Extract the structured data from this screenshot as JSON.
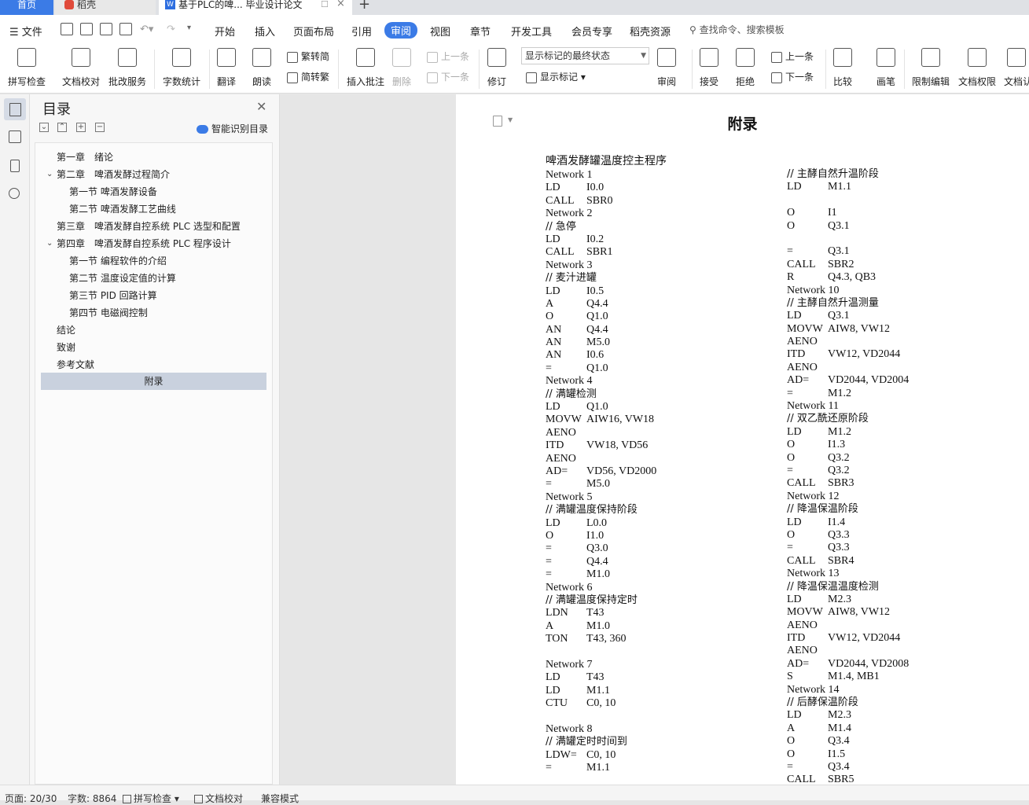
{
  "tabs": {
    "home": "首页",
    "daoke": "稻壳",
    "doc": "基于PLC的啤... 毕业设计论文",
    "new_tab": "+"
  },
  "menu": {
    "file": "文件",
    "items": [
      "开始",
      "插入",
      "页面布局",
      "引用",
      "审阅",
      "视图",
      "章节",
      "开发工具",
      "会员专享",
      "稻壳资源"
    ],
    "active": "审阅",
    "search": "查找命令、搜索模板"
  },
  "ribbon": {
    "spell": "拼写检查",
    "doccheck": "文档校对",
    "review_service": "批改服务",
    "wordcount": "字数统计",
    "translate": "翻译",
    "read": "朗读",
    "trad": "繁转简",
    "simp": "简转繁",
    "insert_comment": "插入批注",
    "delete": "删除",
    "prev": "上一条",
    "next": "下一条",
    "track": "修订",
    "markup_select": "显示标记的最终状态",
    "show_markup": "显示标记",
    "review": "审阅",
    "accept": "接受",
    "reject": "拒绝",
    "prev2": "上一条",
    "next2": "下一条",
    "compare": "比较",
    "pen": "画笔",
    "restrict": "限制编辑",
    "perm": "文档权限",
    "cert": "文档认"
  },
  "nav": {
    "title": "目录",
    "smart": "智能识别目录",
    "items": [
      "第一章　绪论",
      "第二章　啤酒发酵过程简介",
      "第一节  啤酒发酵设备",
      "第二节  啤酒发酵工艺曲线",
      "第三章　啤酒发酵自控系统 PLC 选型和配置",
      "第四章　啤酒发酵自控系统 PLC 程序设计",
      "第一节  编程软件的介绍",
      "第二节  温度设定值的计算",
      "第三节  PID 回路计算",
      "第四节  电磁阀控制",
      "结论",
      "致谢",
      "参考文献",
      "附录"
    ]
  },
  "document": {
    "title": "附录",
    "heading": "啤酒发酵罐温度控主程序",
    "col1": [
      [
        "Network 1",
        ""
      ],
      [
        "LD",
        "I0.0"
      ],
      [
        "CALL",
        "SBR0"
      ],
      [
        "Network 2",
        ""
      ],
      [
        "// 急停",
        ""
      ],
      [
        "LD",
        "I0.2"
      ],
      [
        "CALL",
        "SBR1"
      ],
      [
        "Network 3",
        ""
      ],
      [
        "// 麦汁进罐",
        ""
      ],
      [
        "LD",
        "I0.5"
      ],
      [
        "A",
        "Q4.4"
      ],
      [
        "O",
        "Q1.0"
      ],
      [
        "AN",
        "Q4.4"
      ],
      [
        "AN",
        "M5.0"
      ],
      [
        "AN",
        "I0.6"
      ],
      [
        "=",
        "Q1.0"
      ],
      [
        "Network 4",
        ""
      ],
      [
        "// 满罐检测",
        ""
      ],
      [
        "LD",
        "Q1.0"
      ],
      [
        "MOVW",
        "AIW16, VW18"
      ],
      [
        "AENO",
        ""
      ],
      [
        "ITD",
        "VW18, VD56"
      ],
      [
        "AENO",
        ""
      ],
      [
        "AD=",
        "VD56, VD2000"
      ],
      [
        "=",
        "M5.0"
      ],
      [
        "Network 5",
        ""
      ],
      [
        "// 满罐温度保持阶段",
        ""
      ],
      [
        "LD",
        "L0.0"
      ],
      [
        "O",
        "I1.0"
      ],
      [
        "=",
        "Q3.0"
      ],
      [
        "=",
        "Q4.4"
      ],
      [
        "=",
        "M1.0"
      ],
      [
        "Network 6",
        ""
      ],
      [
        "// 满罐温度保持定时",
        ""
      ],
      [
        "LDN",
        "T43"
      ],
      [
        "A",
        "M1.0"
      ],
      [
        "TON",
        "T43, 360"
      ],
      [
        "",
        ""
      ],
      [
        "Network 7",
        ""
      ],
      [
        "LD",
        "T43"
      ],
      [
        "LD",
        "M1.1"
      ],
      [
        "CTU",
        "C0, 10"
      ],
      [
        "",
        ""
      ],
      [
        "Network 8",
        ""
      ],
      [
        "// 满罐定时时间到",
        ""
      ],
      [
        "LDW=",
        "C0, 10"
      ],
      [
        "=",
        "M1.1"
      ]
    ],
    "col2": [
      [
        "// 主酵自然升温阶段",
        ""
      ],
      [
        "LD",
        "M1.1"
      ],
      [
        "",
        ""
      ],
      [
        "O",
        "I1"
      ],
      [
        "O",
        "Q3.1"
      ],
      [
        "",
        ""
      ],
      [
        "=",
        "Q3.1"
      ],
      [
        "CALL",
        "SBR2"
      ],
      [
        "R",
        "Q4.3, QB3"
      ],
      [
        "Network 10",
        ""
      ],
      [
        "// 主酵自然升温测量",
        ""
      ],
      [
        "LD",
        "Q3.1"
      ],
      [
        "MOVW",
        "AIW8, VW12"
      ],
      [
        "AENO",
        ""
      ],
      [
        "ITD",
        "VW12, VD2044"
      ],
      [
        "AENO",
        ""
      ],
      [
        "AD=",
        "VD2044, VD2004"
      ],
      [
        "=",
        "M1.2"
      ],
      [
        "Network 11",
        ""
      ],
      [
        "// 双乙酰还原阶段",
        ""
      ],
      [
        "LD",
        "M1.2"
      ],
      [
        "O",
        "I1.3"
      ],
      [
        "O",
        "Q3.2"
      ],
      [
        "=",
        "Q3.2"
      ],
      [
        "CALL",
        "SBR3"
      ],
      [
        "Network 12",
        ""
      ],
      [
        "// 降温保温阶段",
        ""
      ],
      [
        "LD",
        "I1.4"
      ],
      [
        "O",
        "Q3.3"
      ],
      [
        "=",
        "Q3.3"
      ],
      [
        "CALL",
        "SBR4"
      ],
      [
        "Network 13",
        ""
      ],
      [
        "// 降温保温温度检测",
        ""
      ],
      [
        "LD",
        "M2.3"
      ],
      [
        "MOVW",
        "AIW8, VW12"
      ],
      [
        "AENO",
        ""
      ],
      [
        "ITD",
        "VW12, VD2044"
      ],
      [
        "AENO",
        ""
      ],
      [
        "AD=",
        "VD2044, VD2008"
      ],
      [
        "S",
        "M1.4, MB1"
      ],
      [
        "Network 14",
        ""
      ],
      [
        "// 后酵保温阶段",
        ""
      ],
      [
        "LD",
        "M2.3"
      ],
      [
        "A",
        "M1.4"
      ],
      [
        "O",
        "Q3.4"
      ],
      [
        "O",
        "I1.5"
      ],
      [
        "=",
        "Q3.4"
      ],
      [
        "CALL",
        "SBR5"
      ]
    ]
  },
  "status": {
    "page": "页面: 20/30",
    "words": "字数: 8864",
    "spell": "拼写检查",
    "check": "文档校对",
    "mode": "兼容模式"
  }
}
